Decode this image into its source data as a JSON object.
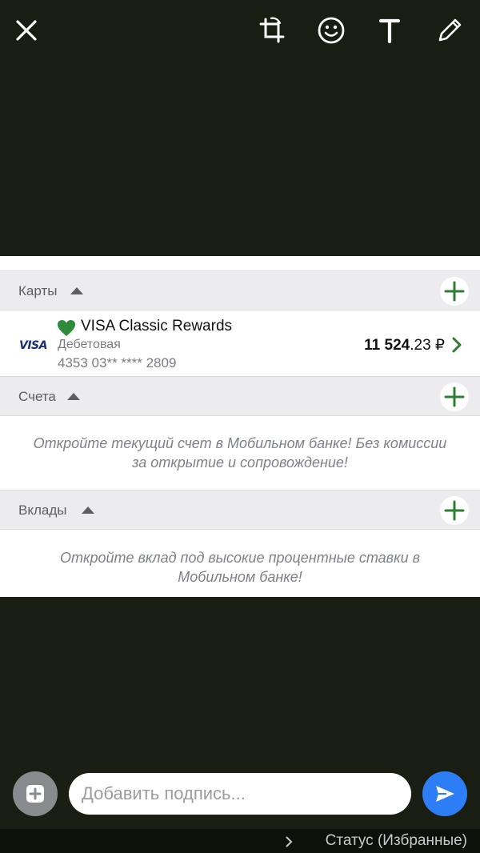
{
  "editor": {
    "tools": [
      "close-icon",
      "crop-rotate-icon",
      "emoji-icon",
      "text-icon",
      "pencil-icon"
    ]
  },
  "screenshot": {
    "cards_section": {
      "title": "Карты"
    },
    "card": {
      "brand": "VISA",
      "name": "VISA Classic Rewards",
      "type": "Дебетовая",
      "number": "4353 03** **** 2809",
      "amount_int": "11 524",
      "amount_frac": ".23 ₽"
    },
    "accounts_section": {
      "title": "Счета",
      "promo": "Откройте текущий счет в Мобильном банке! Без комиссии за открытие и сопровождение!"
    },
    "deposits_section": {
      "title": "Вклады",
      "promo": "Откройте вклад под высокие процентные ставки в Мобильном банке!"
    }
  },
  "caption": {
    "placeholder": "Добавить подпись..."
  },
  "status": {
    "label": "Статус (Избранные)"
  },
  "colors": {
    "accent_green": "#2e7d32",
    "send_blue": "#2d7df6"
  }
}
